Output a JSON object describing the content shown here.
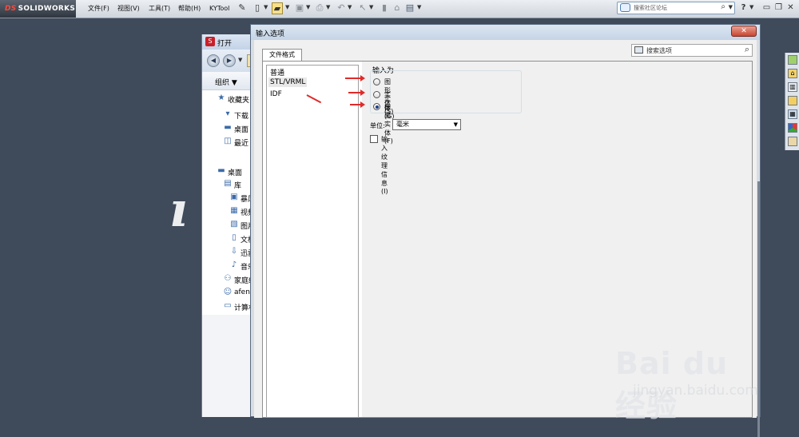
{
  "app": {
    "logo_prefix": "DS",
    "logo_text": "SOLIDWORKS"
  },
  "menu": [
    {
      "label": "文件(F)"
    },
    {
      "label": "视图(V)"
    },
    {
      "label": "工具(T)"
    },
    {
      "label": "帮助(H)"
    },
    {
      "label": "KYTool"
    }
  ],
  "community_search": {
    "placeholder": "搜索社区论坛"
  },
  "toolbar_glyphs": {
    "help": "?",
    "minimize": "▭",
    "restore": "❐",
    "close": "✕"
  },
  "open_dialog": {
    "title": "打开",
    "organize": "组织 ▼",
    "tree": [
      {
        "icon": "star-icon",
        "glyph": "★",
        "label": "收藏夹"
      },
      {
        "icon": "download-folder-icon",
        "glyph": "▾",
        "label": "下载"
      },
      {
        "icon": "desktop-icon",
        "glyph": "▬",
        "label": "桌面"
      },
      {
        "icon": "recent-icon",
        "glyph": "◫",
        "label": "最近"
      },
      {
        "icon": "desktop-icon",
        "glyph": "▬",
        "label": "桌面"
      },
      {
        "icon": "library-icon",
        "glyph": "▤",
        "label": "库"
      },
      {
        "icon": "storm-icon",
        "glyph": "▣",
        "label": "暴风"
      },
      {
        "icon": "video-icon",
        "glyph": "▦",
        "label": "视频"
      },
      {
        "icon": "picture-icon",
        "glyph": "▧",
        "label": "图片"
      },
      {
        "icon": "document-icon",
        "glyph": "▯",
        "label": "文档"
      },
      {
        "icon": "thunder-icon",
        "glyph": "⇩",
        "label": "迅雷"
      },
      {
        "icon": "music-icon",
        "glyph": "♪",
        "label": "音乐"
      },
      {
        "icon": "homegroup-icon",
        "glyph": "⚇",
        "label": "家庭组"
      },
      {
        "icon": "user-icon",
        "glyph": "☺",
        "label": "afeng"
      },
      {
        "icon": "computer-icon",
        "glyph": "▭",
        "label": "计算机"
      }
    ]
  },
  "import_dialog": {
    "title": "输入选项",
    "close_glyph": "✕",
    "tab_label": "文件格式",
    "search_placeholder": "搜索选项",
    "formats": [
      {
        "label": "普通",
        "selected": false
      },
      {
        "label": "STL/VRML",
        "selected": true
      },
      {
        "label": "IDF",
        "selected": false
      }
    ],
    "import_as_label": "输入为",
    "import_as_options": [
      {
        "label": "图形实体(G)",
        "checked": false
      },
      {
        "label": "实体(S)",
        "checked": false
      },
      {
        "label": "曲面实体(F)",
        "checked": true
      }
    ],
    "unit_label": "单位:",
    "unit_value": "毫米",
    "texture_label": "输入纹理信息(I)",
    "texture_checked": false
  },
  "watermark": {
    "brand": "Bai du 经验",
    "url": "jingyan.baidu.com"
  },
  "colors": {
    "desktop": "#3f4a5a",
    "annotation_arrow": "#e02a2a",
    "close_button": "#c9452f"
  }
}
